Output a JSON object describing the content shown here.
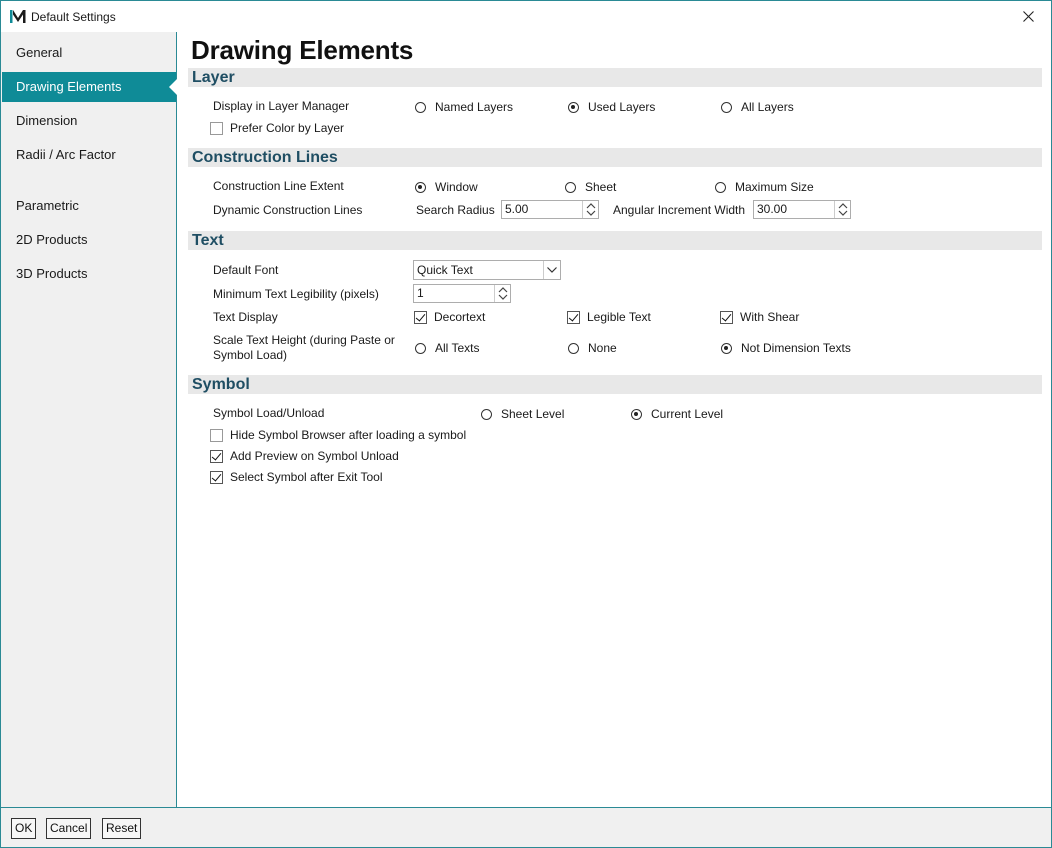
{
  "window": {
    "title": "Default Settings",
    "icon": "app-logo-icon"
  },
  "sidebar": {
    "items": [
      {
        "label": "General"
      },
      {
        "label": "Drawing Elements",
        "active": true
      },
      {
        "label": "Dimension"
      },
      {
        "label": "Radii / Arc Factor"
      },
      {
        "label": "Parametric"
      },
      {
        "label": "2D Products"
      },
      {
        "label": "3D Products"
      }
    ]
  },
  "main": {
    "title": "Drawing Elements",
    "layer": {
      "header": "Layer",
      "display_label": "Display in Layer Manager",
      "options": [
        "Named Layers",
        "Used Layers",
        "All Layers"
      ],
      "selected": "Used Layers",
      "prefer_color_label": "Prefer Color by Layer",
      "prefer_color_checked": false
    },
    "construction": {
      "header": "Construction Lines",
      "extent_label": "Construction Line Extent",
      "extent_options": [
        "Window",
        "Sheet",
        "Maximum Size"
      ],
      "extent_selected": "Window",
      "dynamic_label": "Dynamic Construction Lines",
      "search_radius_label": "Search Radius",
      "search_radius_value": "5.00",
      "angular_label": "Angular Increment Width",
      "angular_value": "30.00"
    },
    "text": {
      "header": "Text",
      "default_font_label": "Default Font",
      "default_font_value": "Quick Text",
      "min_legibility_label": "Minimum Text Legibility (pixels)",
      "min_legibility_value": "1",
      "display_label": "Text Display",
      "display_options": [
        {
          "label": "Decortext",
          "checked": true
        },
        {
          "label": "Legible Text",
          "checked": true
        },
        {
          "label": "With Shear",
          "checked": true
        }
      ],
      "scale_label_line1": "Scale Text Height (during Paste or",
      "scale_label_line2": "Symbol Load)",
      "scale_options": [
        "All Texts",
        "None",
        "Not Dimension Texts"
      ],
      "scale_selected": "Not Dimension Texts"
    },
    "symbol": {
      "header": "Symbol",
      "load_label": "Symbol Load/Unload",
      "load_options": [
        "Sheet Level",
        "Current Level"
      ],
      "load_selected": "Current Level",
      "hide_browser_label": "Hide Symbol Browser after loading a symbol",
      "hide_browser_checked": false,
      "add_preview_label": "Add Preview on Symbol Unload",
      "add_preview_checked": true,
      "select_symbol_label": "Select Symbol after Exit Tool",
      "select_symbol_checked": true
    }
  },
  "buttons": {
    "ok": "OK",
    "cancel": "Cancel",
    "reset": "Reset"
  },
  "colors": {
    "accent": "#0f8b97",
    "section_text": "#1f4e63",
    "section_bg": "#e8e8e8"
  }
}
